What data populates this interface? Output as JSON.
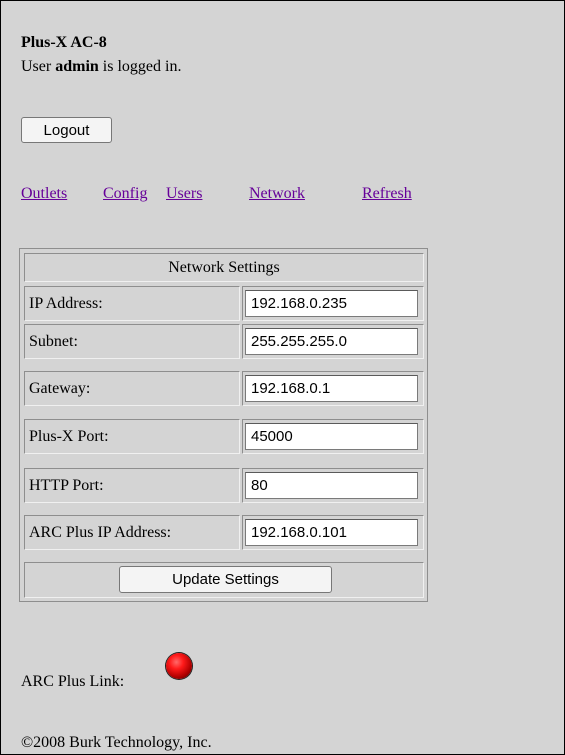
{
  "header": {
    "device_name": "Plus-X AC-8",
    "login_prefix": "User ",
    "username": "admin",
    "login_suffix": " is logged in."
  },
  "logout_label": "Logout",
  "nav": {
    "outlets": "Outlets",
    "config": "Config",
    "users": "Users",
    "network": "Network",
    "refresh": "Refresh"
  },
  "network_settings": {
    "title": "Network Settings",
    "rows": [
      {
        "label": "IP Address:",
        "value": "192.168.0.235"
      },
      {
        "label": "Subnet:",
        "value": "255.255.255.0"
      },
      {
        "label": "Gateway:",
        "value": "192.168.0.1"
      },
      {
        "label": "Plus-X Port:",
        "value": "45000"
      },
      {
        "label": "HTTP Port:",
        "value": "80"
      },
      {
        "label": "ARC Plus IP Address:",
        "value": "192.168.0.101"
      }
    ],
    "update_label": "Update Settings"
  },
  "link_status": {
    "label": "ARC Plus Link:",
    "indicator_color": "#ff1a1a",
    "indicator_icon": "status-led-icon"
  },
  "footer": {
    "copyright": "©2008 Burk Technology, Inc."
  },
  "colors": {
    "background": "#d4d4d4",
    "link": "#660099"
  }
}
